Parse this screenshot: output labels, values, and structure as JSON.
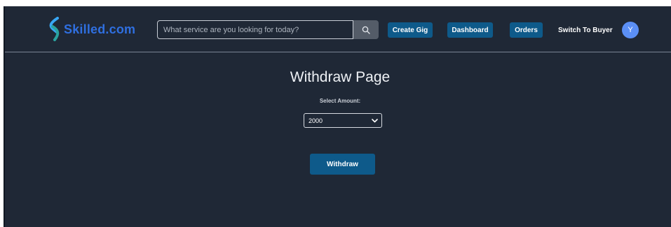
{
  "brand": {
    "name": "Skilled.com",
    "logo_icon": "s-swoosh-logo"
  },
  "search": {
    "placeholder": "What service are you looking for today?",
    "value": "",
    "icon": "search-icon"
  },
  "nav": {
    "create_gig": "Create Gig",
    "dashboard": "Dashboard",
    "orders": "Orders",
    "switch_to_buyer": "Switch To Buyer",
    "avatar_initial": "Y"
  },
  "main": {
    "title": "Withdraw Page",
    "amount_label": "Select Amount:",
    "amount_selected": "2000",
    "withdraw_label": "Withdraw"
  },
  "colors": {
    "background": "#1f2836",
    "primary_button": "#0e5a8a",
    "brand_blue": "#2f6fe0",
    "avatar": "#5b8ff5"
  }
}
